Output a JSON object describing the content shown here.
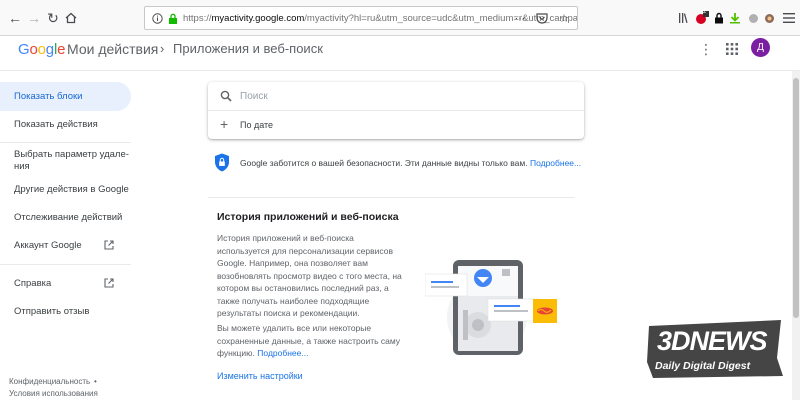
{
  "browser": {
    "url_prefix": "https://",
    "url_host": "myactivity.google.com",
    "url_path": "/myactivity?hl=ru&utm_source=udc&utm_medium=r&utm_campaign=",
    "badge_count": "2"
  },
  "header": {
    "logo": "Google",
    "app_title": "Мои действия",
    "breadcrumb": "Приложения и веб-поиск",
    "avatar_letter": "Д"
  },
  "sidebar": {
    "items": [
      {
        "label": "Показать блоки"
      },
      {
        "label": "Показать действия"
      },
      {
        "label": "Выбрать параметр удале-\nния"
      },
      {
        "label": "Другие действия в Google"
      },
      {
        "label": "Отслеживание действий"
      },
      {
        "label": "Аккаунт Google"
      },
      {
        "label": "Справка"
      },
      {
        "label": "Отправить отзыв"
      }
    ],
    "footer": {
      "privacy": "Конфиденциальность",
      "bullet": "•",
      "terms": "Условия использования"
    }
  },
  "search": {
    "placeholder": "Поиск",
    "date_filter": "По дате"
  },
  "privacy_notice": {
    "text": "Google заботится о вашей безопасности. Эти данные видны только вам.",
    "link": "Подробнее..."
  },
  "info": {
    "title": "История приложений и веб-поиска",
    "desc": "История приложений и веб-поиска используется для персонализации сервисов Google. Например, она позволяет вам возобновлять просмотр видео с того места, на котором вы остановились последний раз, а также получать наиболее подходящие результаты поиска и рекомендации.",
    "desc2": "Вы можете удалить все или некоторые сохраненные данные, а также настроить саму функцию.",
    "desc2_link": "Подробнее...",
    "change_link": "Изменить настройки"
  },
  "watermark": {
    "main": "3DNEWS",
    "sub": "Daily Digital Digest"
  },
  "colors": {
    "accent": "#1a73e8",
    "active_bg": "#e8f0fe",
    "avatar": "#7b1fa2"
  }
}
